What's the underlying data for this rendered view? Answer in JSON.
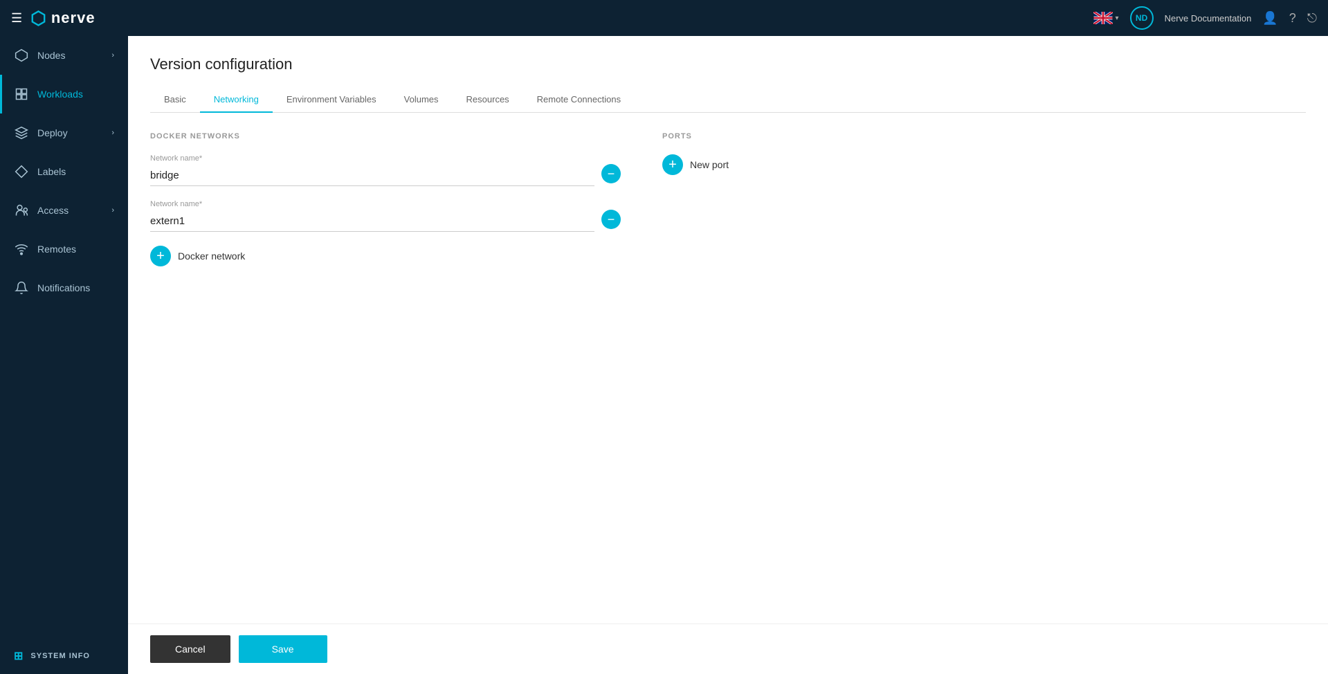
{
  "topnav": {
    "hamburger_label": "☰",
    "logo_text": "nerve",
    "avatar_initials": "ND",
    "doc_link_text": "Nerve Documentation",
    "user_icon": "👤",
    "help_icon": "?",
    "logout_icon": "⎋",
    "chevron_down": "▾"
  },
  "sidebar": {
    "items": [
      {
        "id": "nodes",
        "label": "Nodes",
        "icon": "⬡",
        "has_chevron": true,
        "active": false
      },
      {
        "id": "workloads",
        "label": "Workloads",
        "icon": "▦",
        "has_chevron": false,
        "active": true
      },
      {
        "id": "deploy",
        "label": "Deploy",
        "icon": "✈",
        "has_chevron": true,
        "active": false
      },
      {
        "id": "labels",
        "label": "Labels",
        "icon": "⬡",
        "has_chevron": false,
        "active": false
      },
      {
        "id": "access",
        "label": "Access",
        "icon": "👥",
        "has_chevron": true,
        "active": false
      },
      {
        "id": "remotes",
        "label": "Remotes",
        "icon": "📡",
        "has_chevron": false,
        "active": false
      },
      {
        "id": "notifications",
        "label": "Notifications",
        "icon": "🔔",
        "has_chevron": false,
        "active": false
      }
    ],
    "system_info_label": "SYSTEM INFO",
    "system_info_icon": "⊞"
  },
  "page": {
    "title": "Version configuration",
    "tabs": [
      {
        "id": "basic",
        "label": "Basic",
        "active": false
      },
      {
        "id": "networking",
        "label": "Networking",
        "active": true
      },
      {
        "id": "environment-variables",
        "label": "Environment Variables",
        "active": false
      },
      {
        "id": "volumes",
        "label": "Volumes",
        "active": false
      },
      {
        "id": "resources",
        "label": "Resources",
        "active": false
      },
      {
        "id": "remote-connections",
        "label": "Remote Connections",
        "active": false
      }
    ]
  },
  "docker_networks": {
    "section_title": "DOCKER NETWORKS",
    "field_label": "Network name*",
    "networks": [
      {
        "id": 1,
        "value": "bridge"
      },
      {
        "id": 2,
        "value": "extern1"
      }
    ],
    "add_label": "Docker network"
  },
  "ports": {
    "section_title": "PORTS",
    "add_label": "New port"
  },
  "footer": {
    "cancel_label": "Cancel",
    "save_label": "Save"
  }
}
